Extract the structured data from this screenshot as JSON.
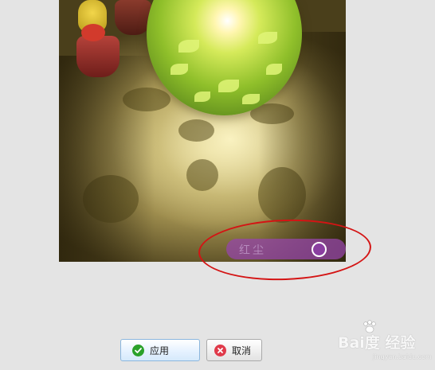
{
  "photo": {
    "watermark_text": "红尘",
    "description_icon": "image-preview"
  },
  "buttons": {
    "apply_label": "应用",
    "cancel_label": "取消"
  },
  "icons": {
    "apply": "check-circle-icon",
    "cancel": "x-circle-icon"
  },
  "brand": {
    "text": "Bai度 经验",
    "sub": "jingyan.baidu.com"
  },
  "colors": {
    "highlight_ring": "#d41414",
    "watermark_band": "#964aaa",
    "apply_icon": "#2aa12a",
    "cancel_icon": "#e03a4a"
  }
}
